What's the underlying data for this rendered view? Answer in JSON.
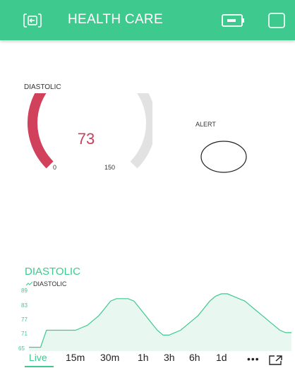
{
  "header": {
    "title": "HEALTH CARE",
    "bg_color": "#3ec98f",
    "left_icon": "back-square-icon",
    "battery_icon": "battery-icon",
    "right_icon": "square-icon"
  },
  "gauge": {
    "label": "DIASTOLIC",
    "value": "73",
    "min": "0",
    "max": "150",
    "fill_fraction": 0.487,
    "fill_color": "#d2415c",
    "track_color": "#e2e2e2"
  },
  "alert": {
    "label": "ALERT"
  },
  "chart": {
    "title": "DIASTOLIC",
    "legend": "DIASTOLIC",
    "ticks": [
      "89",
      "83",
      "77",
      "71",
      "65"
    ],
    "ranges": [
      "Live",
      "15m",
      "30m",
      "1h",
      "3h",
      "6h",
      "1d"
    ],
    "active_range": "Live",
    "more_label": "•••",
    "expand_icon": "expand-icon"
  },
  "chart_data": {
    "type": "area",
    "title": "DIASTOLIC",
    "series": [
      {
        "name": "DIASTOLIC",
        "x": [
          0,
          1,
          2,
          3,
          4,
          5,
          6,
          7,
          8,
          9,
          10,
          11,
          12,
          13,
          14,
          15,
          16,
          17,
          18,
          19,
          20,
          21,
          22,
          23,
          24,
          25,
          26,
          27,
          28,
          29,
          30,
          31,
          32,
          33,
          34,
          35,
          36,
          37,
          38,
          39,
          40,
          41,
          42,
          43,
          44,
          45
        ],
        "values": [
          65,
          65,
          65,
          72,
          72,
          72,
          72,
          72,
          72,
          73,
          74,
          76,
          78,
          81,
          84,
          85,
          85,
          85,
          84,
          81,
          78,
          75,
          72,
          70,
          70,
          71,
          72,
          74,
          76,
          78,
          81,
          84,
          86,
          87,
          87,
          86,
          85,
          84,
          82,
          80,
          78,
          76,
          74,
          72,
          71,
          71
        ]
      }
    ],
    "ylim": [
      64,
      89
    ],
    "color": "#3ec98f"
  }
}
